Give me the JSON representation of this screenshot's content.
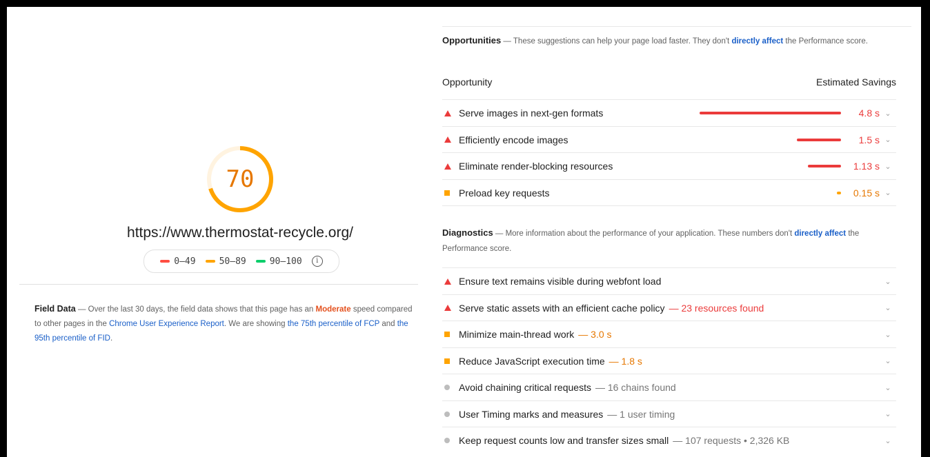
{
  "gauge": {
    "score": "70",
    "fraction": 0.7,
    "color": "#ffa400"
  },
  "url": "https://www.thermostat-recycle.org/",
  "legend": [
    {
      "label": "0–49",
      "color": "#ff4e42"
    },
    {
      "label": "50–89",
      "color": "#ffa400"
    },
    {
      "label": "90–100",
      "color": "#0cce6b"
    }
  ],
  "field_data": {
    "title": "Field Data",
    "text1": " — Over the last 30 days, the field data shows that this page has an ",
    "rating": "Moderate",
    "text2": " speed compared to other pages in the ",
    "link1": "Chrome User Experience Report",
    "text3": ". We are showing ",
    "link2": "the 75th percentile of FCP",
    "text4": " and ",
    "link3": "the 95th percentile of FID",
    "text5": "."
  },
  "opportunities": {
    "title": "Opportunities",
    "desc1": " — These suggestions can help your page load faster. They don't ",
    "link": "directly affect",
    "desc2": " the Performance score.",
    "col_left": "Opportunity",
    "col_right": "Estimated Savings",
    "items": [
      {
        "label": "Serve images in next-gen formats",
        "saving": "4.8 s",
        "value": 4.8,
        "severity": "fail",
        "color": "#eb3b3b"
      },
      {
        "label": "Efficiently encode images",
        "saving": "1.5 s",
        "value": 1.5,
        "severity": "fail",
        "color": "#eb3b3b"
      },
      {
        "label": "Eliminate render-blocking resources",
        "saving": "1.13 s",
        "value": 1.13,
        "severity": "fail",
        "color": "#eb3b3b"
      },
      {
        "label": "Preload key requests",
        "saving": "0.15 s",
        "value": 0.15,
        "severity": "average",
        "color": "#e67700"
      }
    ]
  },
  "diagnostics": {
    "title": "Diagnostics",
    "desc1": " — More information about the performance of your application. These numbers don't ",
    "link": "directly affect",
    "desc2": " the Performance score.",
    "items": [
      {
        "label": "Ensure text remains visible during webfont load",
        "detail": "",
        "severity": "fail"
      },
      {
        "label": "Serve static assets with an efficient cache policy",
        "detail": "— 23 resources found",
        "severity": "fail"
      },
      {
        "label": "Minimize main-thread work",
        "detail": "— 3.0 s",
        "severity": "average"
      },
      {
        "label": "Reduce JavaScript execution time",
        "detail": "— 1.8 s",
        "severity": "average"
      },
      {
        "label": "Avoid chaining critical requests",
        "detail": "— 16 chains found",
        "severity": "info"
      },
      {
        "label": "User Timing marks and measures",
        "detail": "— 1 user timing",
        "severity": "info"
      },
      {
        "label": "Keep request counts low and transfer sizes small",
        "detail": "— 107 requests • 2,326 KB",
        "severity": "info"
      }
    ]
  },
  "colors": {
    "fail": "#eb3b3b",
    "average": "#ffa400",
    "average_text": "#e67700",
    "info": "#bdbdbd",
    "link": "#1a5fc8"
  }
}
